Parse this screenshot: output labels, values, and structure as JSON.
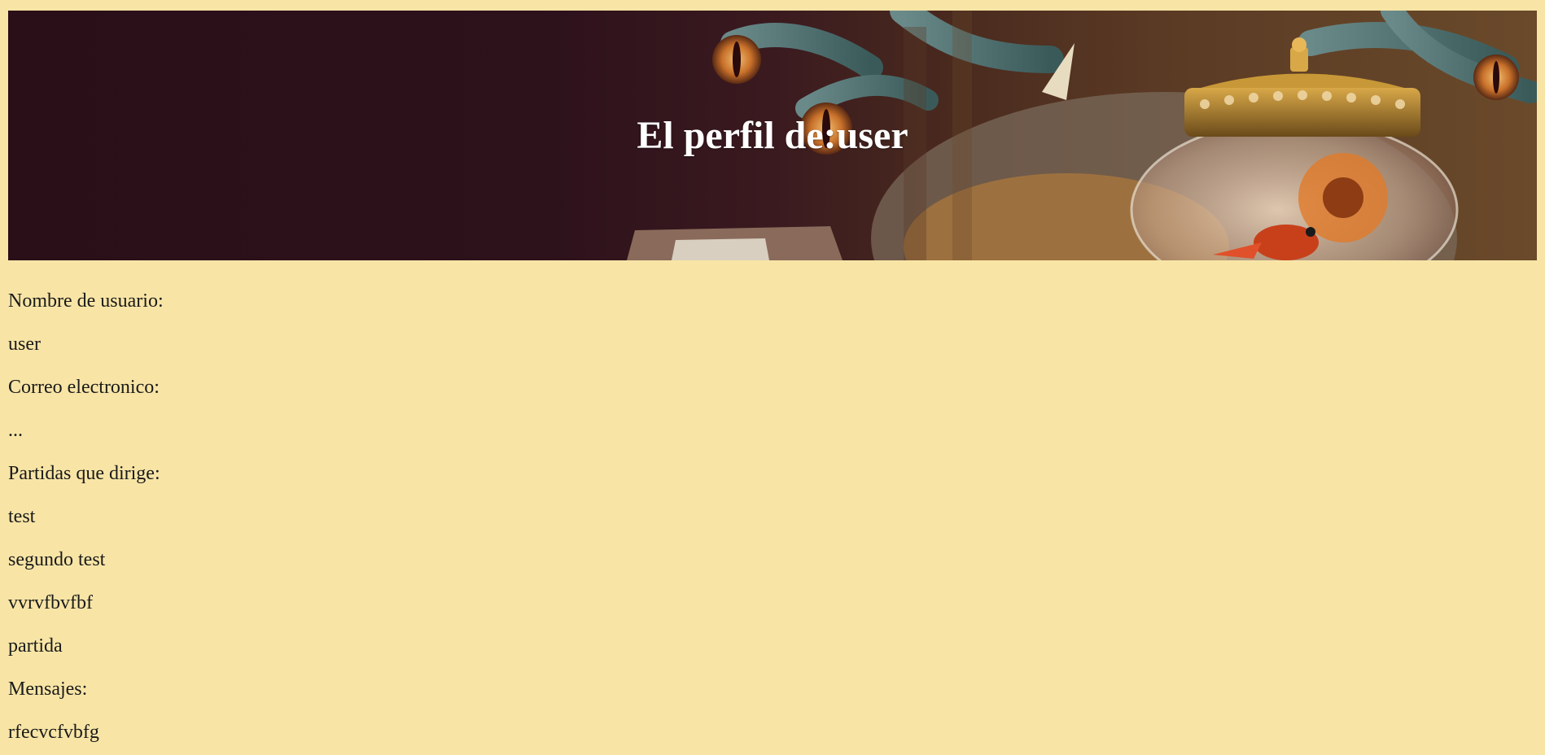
{
  "header": {
    "title": "El perfil de:user"
  },
  "profile": {
    "username_label": "Nombre de usuario:",
    "username_value": "user",
    "email_label": "Correo electronico:",
    "email_value": "...",
    "games_label": "Partidas que dirige:",
    "games": [
      "test",
      "segundo test",
      "vvrvfbvfbf",
      "partida"
    ],
    "messages_label": "Mensajes:",
    "messages": [
      "rfecvcfvbfg"
    ]
  },
  "colors": {
    "page_background": "#f8e5a6",
    "title_text": "#ffffff",
    "body_text": "#1a1a1a"
  }
}
